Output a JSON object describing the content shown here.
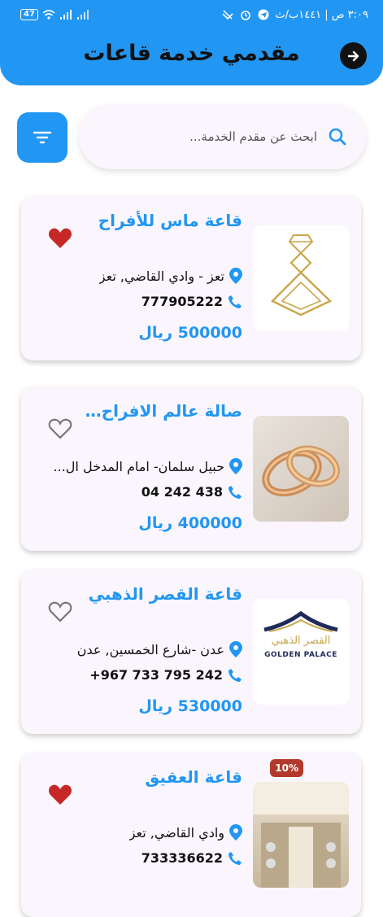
{
  "status_bar": {
    "time": "٣:٠٩ ص | ١٤٤١ب/ث",
    "battery": "47"
  },
  "header": {
    "title": "مقدمي خدمة قاعات"
  },
  "search": {
    "placeholder": "ابحث عن مقدم الخدمة..."
  },
  "colors": {
    "primary": "#2196f3",
    "heart_active": "#c62828",
    "card_bg": "#fbf6fd"
  },
  "cards": [
    {
      "name": "قاعة ماس للأفراح",
      "location": "تعز - وادي القاضي, تعز",
      "phone": "777905222",
      "price": "500000 ريال",
      "favorite": true,
      "image": "diamond-logo"
    },
    {
      "name": "صالة عالم الافراح ...",
      "location": "حبيل سلمان- امام المدخل ال...",
      "phone": "04 242 438",
      "price": "400000 ريال",
      "favorite": false,
      "image": "wedding-rings-photo"
    },
    {
      "name": "قاعة القصر الذهبي",
      "location": "عدن -شارع الخمسين, عدن",
      "phone": "+967 733 795 242",
      "price": "530000 ريال",
      "favorite": false,
      "image": "golden-palace-logo",
      "logo_text_ar": "القصر الذهبي",
      "logo_text_en": "GOLDEN PALACE"
    },
    {
      "name": "قاعة العقيق",
      "location": "وادي القاضي, تعز",
      "phone": "733336622",
      "price": "",
      "favorite": true,
      "image": "hall-interior-photo",
      "discount": "10%"
    }
  ]
}
